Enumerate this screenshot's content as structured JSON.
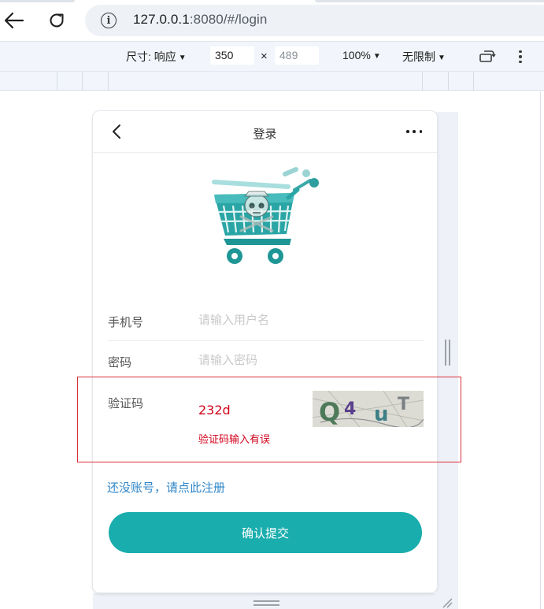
{
  "browser": {
    "url_host": "127.0.0.1",
    "url_rest": ":8080/#/login",
    "info_symbol": "i"
  },
  "device_toolbar": {
    "dimension_label": "尺寸: 响应",
    "width_value": "350",
    "times_symbol": "×",
    "height_placeholder": "489",
    "zoom": "100%",
    "throttle": "无限制"
  },
  "page": {
    "title": "登录",
    "logo_icon": "shopping-cart-with-skull-icon",
    "accent_color": "#1aadad",
    "error_color": "#d0021b",
    "link_color": "#2f86c9"
  },
  "form": {
    "phone": {
      "label": "手机号",
      "placeholder": "请输入用户名"
    },
    "password": {
      "label": "密码",
      "placeholder": "请输入密码"
    },
    "captcha": {
      "label": "验证码",
      "value": "232d",
      "error": "验证码输入有误",
      "image_text": "Q4uT"
    }
  },
  "register_link": "还没账号，请点此注册",
  "submit_label": "确认提交"
}
